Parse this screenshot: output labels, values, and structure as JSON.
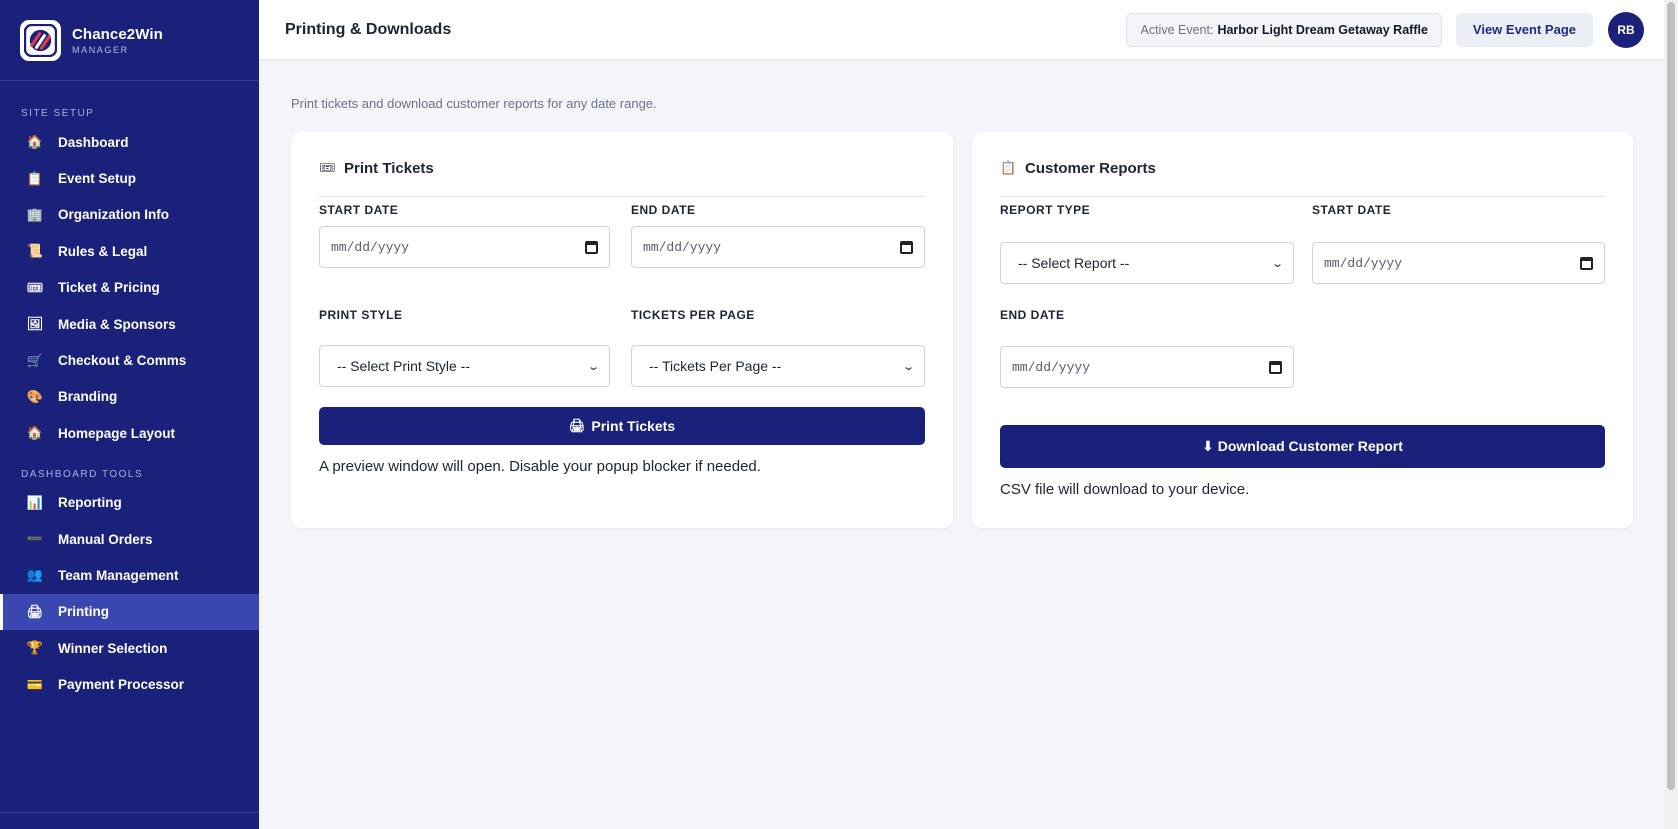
{
  "brand": {
    "name": "Chance2Win",
    "sub": "MANAGER"
  },
  "sidebar": {
    "sections": [
      {
        "title": "SITE SETUP",
        "items": [
          {
            "label": "Dashboard",
            "icon": "🏠"
          },
          {
            "label": "Event Setup",
            "icon": "📋"
          },
          {
            "label": "Organization Info",
            "icon": "🏢"
          },
          {
            "label": "Rules & Legal",
            "icon": "📜"
          },
          {
            "label": "Ticket & Pricing",
            "icon": "🎟"
          },
          {
            "label": "Media & Sponsors",
            "icon": "🖼"
          },
          {
            "label": "Checkout & Comms",
            "icon": "🛒"
          },
          {
            "label": "Branding",
            "icon": "🎨"
          },
          {
            "label": "Homepage Layout",
            "icon": "🏠"
          }
        ]
      },
      {
        "title": "DASHBOARD TOOLS",
        "items": [
          {
            "label": "Reporting",
            "icon": "📊"
          },
          {
            "label": "Manual Orders",
            "icon": "➖"
          },
          {
            "label": "Team Management",
            "icon": "👥"
          },
          {
            "label": "Printing",
            "icon": "🖨",
            "active": true
          },
          {
            "label": "Winner Selection",
            "icon": "🏆"
          },
          {
            "label": "Payment Processor",
            "icon": "💳"
          }
        ]
      }
    ]
  },
  "header": {
    "title": "Printing & Downloads",
    "active_event_label": "Active Event:",
    "active_event_value": "Harbor Light Dream Getaway Raffle",
    "view_event_label": "View Event Page",
    "avatar_initials": "RB"
  },
  "main": {
    "subtitle": "Print tickets and download customer reports for any date range.",
    "print_card": {
      "icon": "🎟",
      "title": "Print Tickets",
      "start_label": "START DATE",
      "start_value": "mm/dd/yyyy",
      "end_label": "END DATE",
      "end_value": "mm/dd/yyyy",
      "style_label": "PRINT STYLE",
      "style_value": "-- Select Print Style --",
      "per_page_label": "TICKETS PER PAGE",
      "per_page_value": "-- Tickets Per Page --",
      "button_icon": "🖨",
      "button_label": "Print Tickets",
      "note": "A preview window will open. Disable your popup blocker if needed."
    },
    "report_card": {
      "icon": "📋",
      "title": "Customer Reports",
      "type_label": "REPORT TYPE",
      "type_value": "-- Select Report --",
      "start_label": "START DATE",
      "start_value": "mm/dd/yyyy",
      "end_label": "END DATE",
      "end_value": "mm/dd/yyyy",
      "button_label": "⬇ Download Customer Report",
      "note": "CSV file will download to your device."
    }
  },
  "colors": {
    "sidebar": "#1a217a",
    "active_item": "#3b47b0",
    "primary": "#1a217a",
    "background": "#f4f5fa"
  }
}
